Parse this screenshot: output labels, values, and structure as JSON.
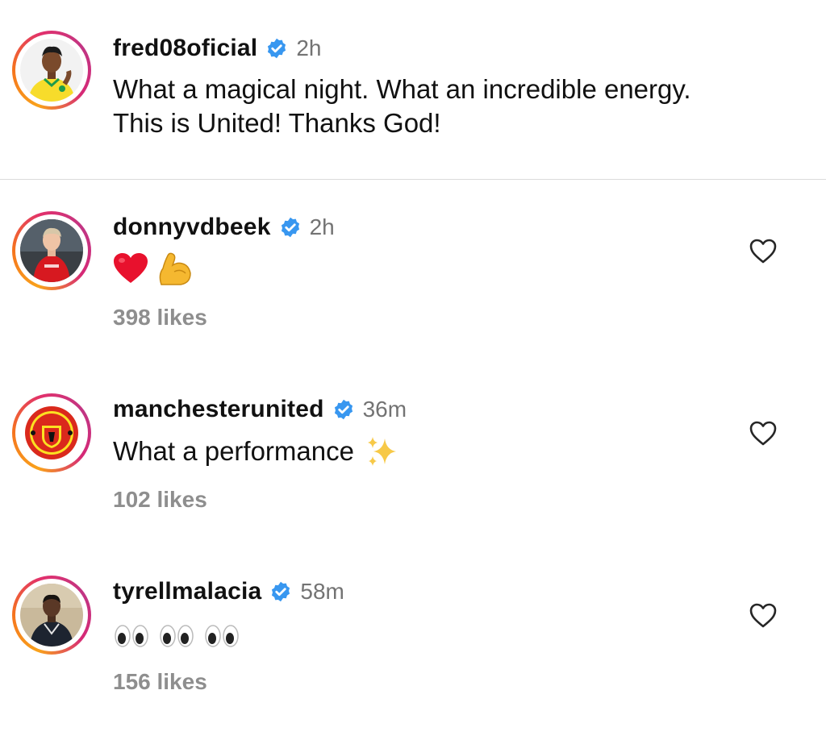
{
  "post": {
    "username": "fred08oficial",
    "time": "2h",
    "caption_line1": "What a magical night. What an incredible energy.",
    "caption_line2": "This is United! Thanks God!",
    "avatar_icon": "avatar-player-yellow-jersey"
  },
  "comments": [
    {
      "username": "donnyvdbeek",
      "time": "2h",
      "text": "",
      "emojis": [
        "red-heart-emoji",
        "flexed-biceps-emoji"
      ],
      "likes": "398 likes",
      "avatar_icon": "avatar-player-red-jersey"
    },
    {
      "username": "manchesterunited",
      "time": "36m",
      "text": "What a performance",
      "emojis": [
        "sparkles-emoji"
      ],
      "likes": "102 likes",
      "avatar_icon": "manchester-united-crest"
    },
    {
      "username": "tyrellmalacia",
      "time": "58m",
      "text": "",
      "emojis": [
        "eyes-emoji",
        "eyes-emoji",
        "eyes-emoji"
      ],
      "likes": "156 likes",
      "avatar_icon": "avatar-player-dark-jacket"
    }
  ],
  "colors": {
    "verified": "#3897f0",
    "muted": "#737373",
    "likes": "#8e8e8e",
    "divider": "#dbdbdb"
  }
}
